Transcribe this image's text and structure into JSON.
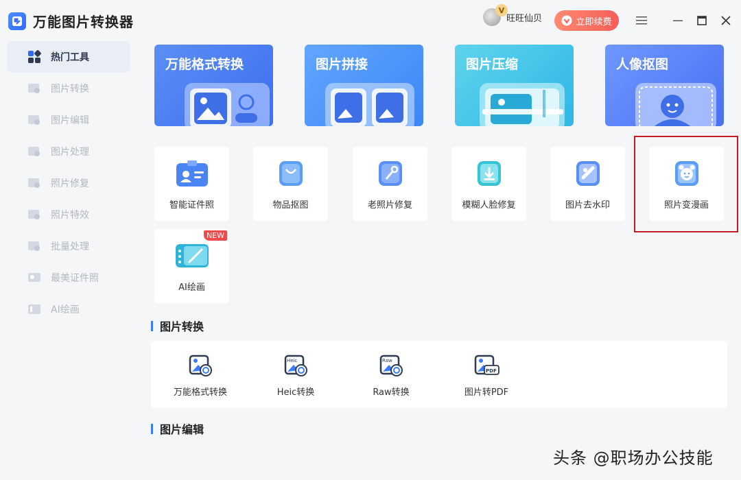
{
  "app": {
    "name": "万能图片转换器"
  },
  "header": {
    "vip_badge": "V",
    "user_name": "旺旺仙贝",
    "renew_label": "立即续费"
  },
  "sidebar": {
    "items": [
      {
        "label": "热门工具",
        "active": true
      },
      {
        "label": "图片转换"
      },
      {
        "label": "图片编辑"
      },
      {
        "label": "图片处理"
      },
      {
        "label": "照片修复"
      },
      {
        "label": "照片特效"
      },
      {
        "label": "批量处理"
      },
      {
        "label": "最美证件照"
      },
      {
        "label": "AI绘画"
      }
    ]
  },
  "feature_cards": [
    {
      "label": "万能格式转换",
      "color_from": "#5b8ef5",
      "color_to": "#3d6ff0"
    },
    {
      "label": "图片拼接",
      "color_from": "#62a6ff",
      "color_to": "#3c86f5"
    },
    {
      "label": "图片压缩",
      "color_from": "#5fd3ec",
      "color_to": "#2fb6e6"
    },
    {
      "label": "人像抠图",
      "color_from": "#6f97ff",
      "color_to": "#4a70f2"
    }
  ],
  "tools": [
    {
      "label": "智能证件照"
    },
    {
      "label": "物品抠图"
    },
    {
      "label": "老照片修复"
    },
    {
      "label": "模糊人脸修复"
    },
    {
      "label": "图片去水印"
    },
    {
      "label": "照片变漫画"
    },
    {
      "label": "AI绘画",
      "badge": "NEW"
    }
  ],
  "sections": {
    "convert_title": "图片转换",
    "edit_title": "图片编辑"
  },
  "convert_items": [
    {
      "label": "万能格式转换",
      "tag": ""
    },
    {
      "label": "Heic转换",
      "tag": "Heic"
    },
    {
      "label": "Raw转换",
      "tag": "Raw"
    },
    {
      "label": "图片转PDF",
      "tag": "PDF"
    }
  ],
  "watermark": "头条 @职场办公技能",
  "colors": {
    "accent": "#3b7bff",
    "highlight": "#c21e24",
    "renew": "#f55e58"
  }
}
